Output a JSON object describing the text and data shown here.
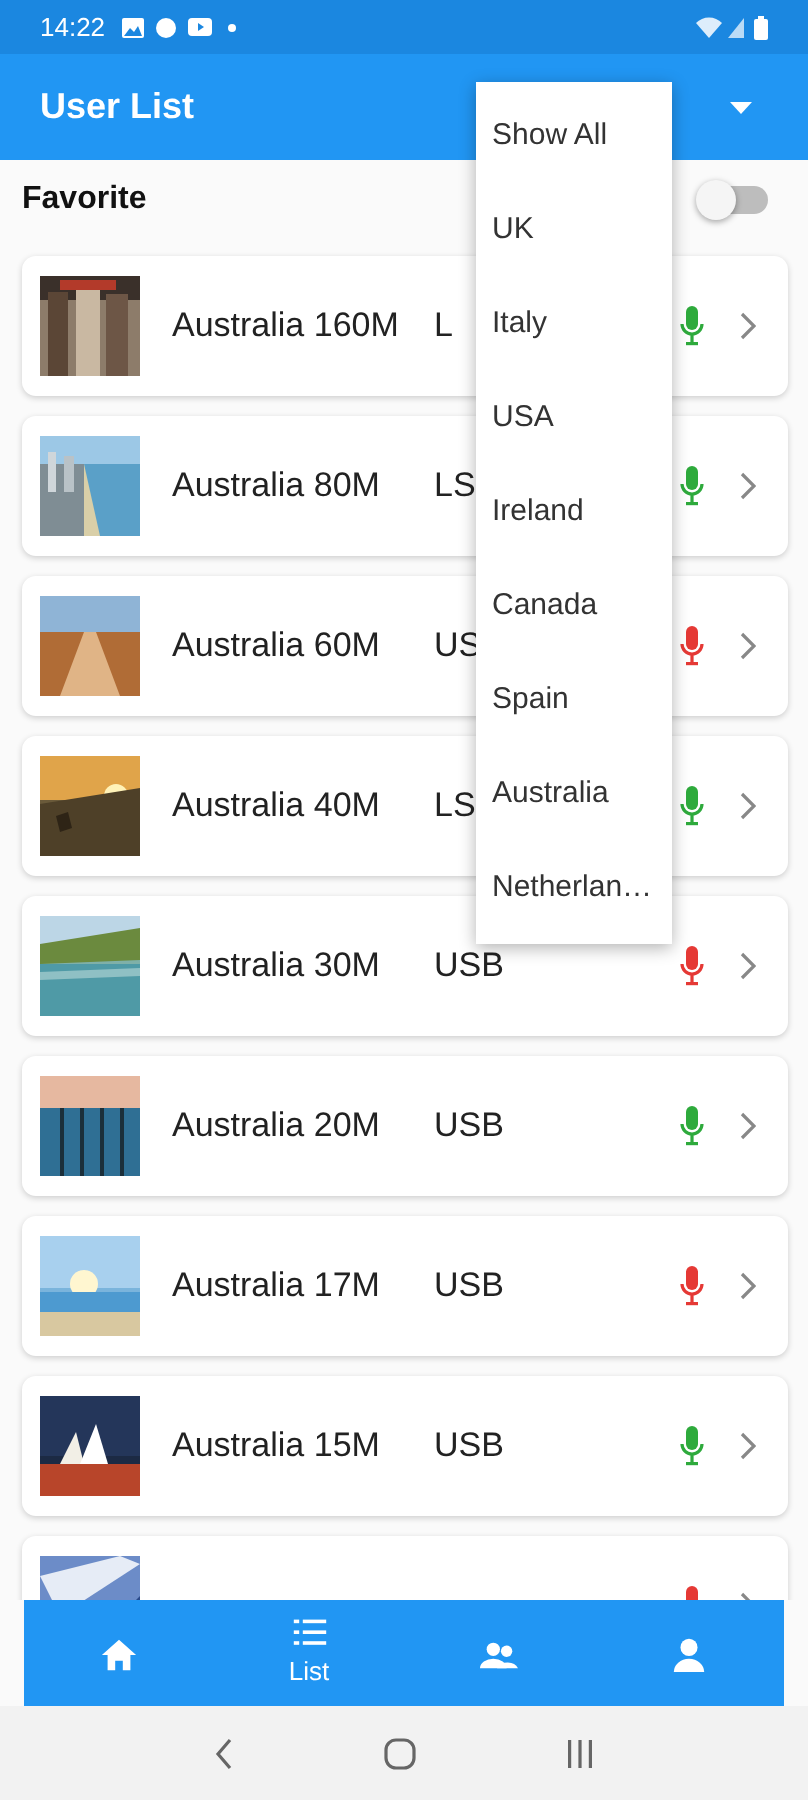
{
  "status_bar": {
    "time": "14:22"
  },
  "app_bar": {
    "title": "User List"
  },
  "favorite": {
    "label": "Favorite",
    "on": false
  },
  "users": [
    {
      "name": "Australia 160M",
      "connection": "L",
      "muted": false
    },
    {
      "name": "Australia 80M",
      "connection": "LS",
      "muted": false
    },
    {
      "name": "Australia 60M",
      "connection": "US",
      "muted": true
    },
    {
      "name": "Australia 40M",
      "connection": "LS",
      "muted": false
    },
    {
      "name": "Australia 30M",
      "connection": "USB",
      "muted": true
    },
    {
      "name": "Australia 20M",
      "connection": "USB",
      "muted": false
    },
    {
      "name": "Australia 17M",
      "connection": "USB",
      "muted": true
    },
    {
      "name": "Australia 15M",
      "connection": "USB",
      "muted": false
    },
    {
      "muted": true
    }
  ],
  "country_menu": {
    "items": [
      "Show All",
      "UK",
      "Italy",
      "USA",
      "Ireland",
      "Canada",
      "Spain",
      "Australia",
      "Netherlan…"
    ]
  },
  "bottom_nav": [
    {
      "kind": "home",
      "selected": false
    },
    {
      "kind": "list",
      "label": "List",
      "selected": true
    },
    {
      "kind": "group",
      "selected": false
    },
    {
      "kind": "person",
      "selected": false
    }
  ]
}
